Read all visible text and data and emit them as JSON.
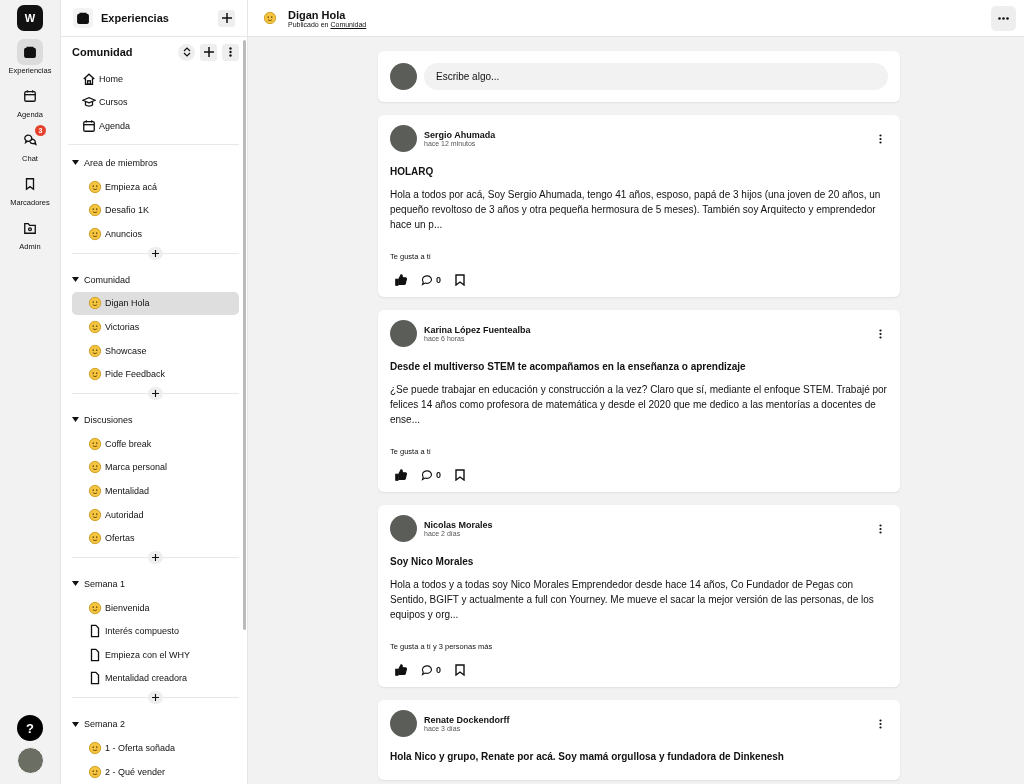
{
  "rail": {
    "logo": "W",
    "items": [
      {
        "label": "Experiencias",
        "kind": "box",
        "selected": true
      },
      {
        "label": "Agenda",
        "kind": "calendar",
        "selected": false
      },
      {
        "label": "Chat",
        "kind": "chat",
        "selected": false,
        "badge": "3"
      },
      {
        "label": "Marcadores",
        "kind": "bookmark",
        "selected": false
      },
      {
        "label": "Admin",
        "kind": "folder",
        "selected": false
      }
    ],
    "help": "?"
  },
  "sidebar": {
    "title": "Experiencias",
    "community": "Comunidad",
    "links": [
      {
        "label": "Home",
        "kind": "home"
      },
      {
        "label": "Cursos",
        "kind": "cap"
      },
      {
        "label": "Agenda",
        "kind": "calendar"
      }
    ],
    "sections": [
      {
        "title": "Area de miembros",
        "expanded": true,
        "items": [
          {
            "label": "Empieza acá",
            "kind": "emoji",
            "selected": false
          },
          {
            "label": "Desafio 1K",
            "kind": "emoji",
            "selected": false
          },
          {
            "label": "Anuncios",
            "kind": "emoji",
            "selected": false
          }
        ]
      },
      {
        "title": "Comunidad",
        "expanded": true,
        "items": [
          {
            "label": "Digan Hola",
            "kind": "emoji",
            "selected": true
          },
          {
            "label": "Victorias",
            "kind": "emoji",
            "selected": false
          },
          {
            "label": "Showcase",
            "kind": "emoji",
            "selected": false
          },
          {
            "label": "Pide Feedback",
            "kind": "emoji",
            "selected": false
          }
        ]
      },
      {
        "title": "Discusiones",
        "expanded": true,
        "items": [
          {
            "label": "Coffe break",
            "kind": "emoji",
            "selected": false
          },
          {
            "label": "Marca personal",
            "kind": "emoji",
            "selected": false
          },
          {
            "label": "Mentalidad",
            "kind": "emoji",
            "selected": false
          },
          {
            "label": "Autoridad",
            "kind": "emoji",
            "selected": false
          },
          {
            "label": "Ofertas",
            "kind": "emoji",
            "selected": false
          }
        ]
      },
      {
        "title": "Semana 1",
        "expanded": true,
        "items": [
          {
            "label": "Bienvenida",
            "kind": "emoji",
            "selected": false
          },
          {
            "label": "Interés compuesto",
            "kind": "document",
            "selected": false
          },
          {
            "label": "Empieza con el WHY",
            "kind": "document",
            "selected": false
          },
          {
            "label": "Mentalidad creadora",
            "kind": "document",
            "selected": false
          }
        ]
      },
      {
        "title": "Semana 2",
        "expanded": true,
        "items": [
          {
            "label": "1 - Oferta soñada",
            "kind": "emoji",
            "selected": false
          },
          {
            "label": "2 - Qué vender",
            "kind": "emoji",
            "selected": false
          }
        ]
      }
    ]
  },
  "header": {
    "title": "Digan Hola",
    "subtitle": "Publicado en",
    "space_link": "Comunidad"
  },
  "composer": {
    "placeholder": "Escribe algo..."
  },
  "posts": [
    {
      "author": "Sergio Ahumada",
      "time": "hace 12 minutos",
      "title": "HOLARQ",
      "body": "Hola a todos por acá, Soy Sergio Ahumada, tengo 41 años, esposo, papá de 3 hijos (una joven de 20 años, un pequeño revoltoso de 3 años y otra pequeña hermosura de 5 meses). También soy Arquitecto y emprendedor hace un p...",
      "likes": "Te gusta a tí",
      "liked": true,
      "comments": "0"
    },
    {
      "author": "Karina López Fuentealba",
      "time": "hace 6 horas",
      "title": "Desde el multiverso STEM te acompañamos en la enseñanza o aprendizaje",
      "body": "¿Se puede trabajar en educación y construcción a la vez? Claro que sí, mediante el enfoque STEM. Trabajé por felices 14 años como profesora de matemática y desde el 2020 que me dedico a las mentorías a docentes de ense...",
      "likes": "Te gusta a tí",
      "liked": true,
      "comments": "0"
    },
    {
      "author": "Nicolas Morales",
      "time": "hace 2 días",
      "title": "Soy Nico Morales",
      "body": "Hola a todos y a todas soy Nico Morales Emprendedor desde hace 14 años, Co Fundador de Pegas con Sentido, BGIFT y actualmente a full con Yourney. Me mueve el sacar la mejor versión de las personas, de los equipos y org...",
      "likes": "Te gusta a tí y 3 personas más",
      "liked": true,
      "comments": "0"
    },
    {
      "author": "Renate Dockendorff",
      "time": "hace 3 días",
      "title": "Hola Nico y grupo, Renate por acá. Soy mamá orgullosa y fundadora de Dinkenesh"
    }
  ]
}
